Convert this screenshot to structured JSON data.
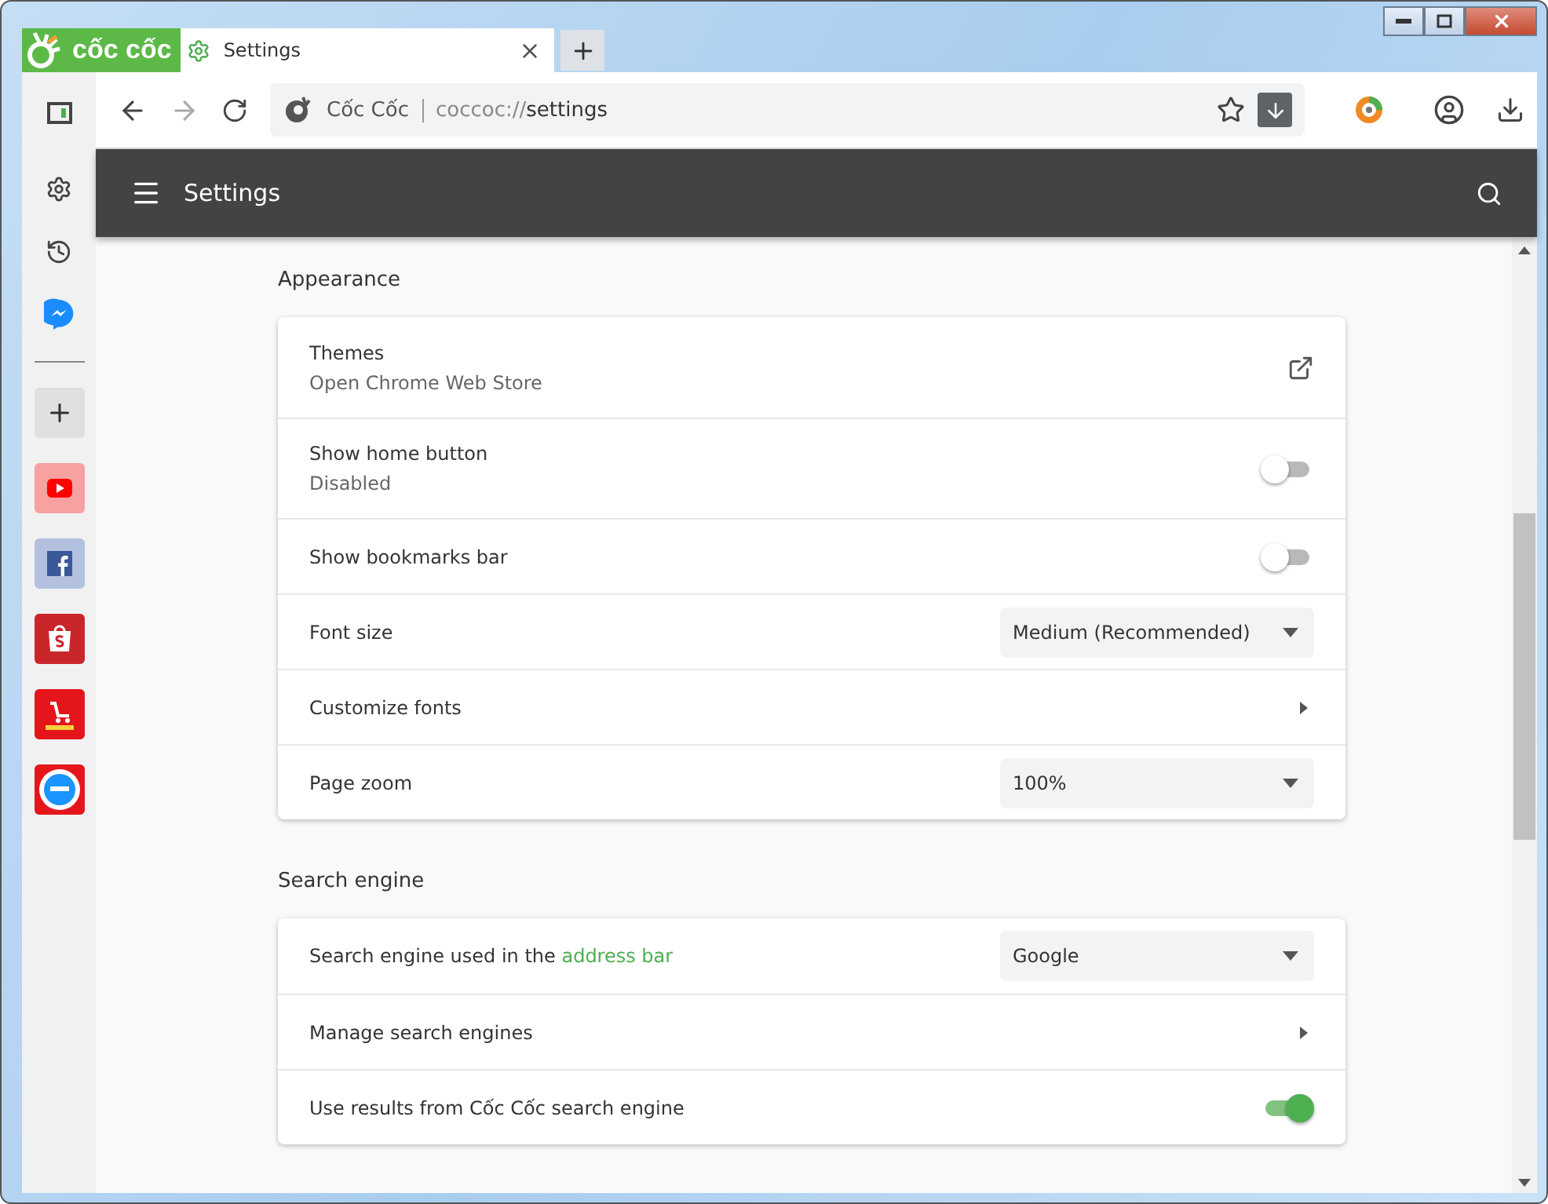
{
  "window": {
    "logo": "cốc cốc"
  },
  "tabs": [
    {
      "label": "Settings",
      "selected": true
    }
  ],
  "address_bar": {
    "site": "Cốc Cốc",
    "url_prefix": "coccoc://",
    "url_path": "settings"
  },
  "sidebar": {
    "items": [
      {
        "kind": "settings"
      },
      {
        "kind": "history"
      },
      {
        "kind": "messenger"
      },
      {
        "kind": "divider"
      },
      {
        "kind": "add"
      },
      {
        "kind": "youtube"
      },
      {
        "kind": "facebook"
      },
      {
        "kind": "shop"
      },
      {
        "kind": "sale"
      },
      {
        "kind": "tiki"
      }
    ]
  },
  "header": {
    "title": "Settings"
  },
  "sections": [
    {
      "title": "Appearance",
      "rows": [
        {
          "kind": "link",
          "label": "Themes",
          "sublabel": "Open Chrome Web Store"
        },
        {
          "kind": "toggle",
          "label": "Show home button",
          "sublabel": "Disabled",
          "on": false
        },
        {
          "kind": "toggle",
          "label": "Show bookmarks bar",
          "on": false
        },
        {
          "kind": "select",
          "label": "Font size",
          "value": "Medium (Recommended)"
        },
        {
          "kind": "arrow",
          "label": "Customize fonts"
        },
        {
          "kind": "select",
          "label": "Page zoom",
          "value": "100%"
        }
      ]
    },
    {
      "title": "Search engine",
      "rows": [
        {
          "kind": "select",
          "label": "Search engine used in the ",
          "link": "address bar",
          "value": "Google"
        },
        {
          "kind": "arrow",
          "label": "Manage search engines"
        },
        {
          "kind": "toggle",
          "label": "Use results from Cốc Cốc search engine",
          "on": true
        }
      ]
    }
  ]
}
